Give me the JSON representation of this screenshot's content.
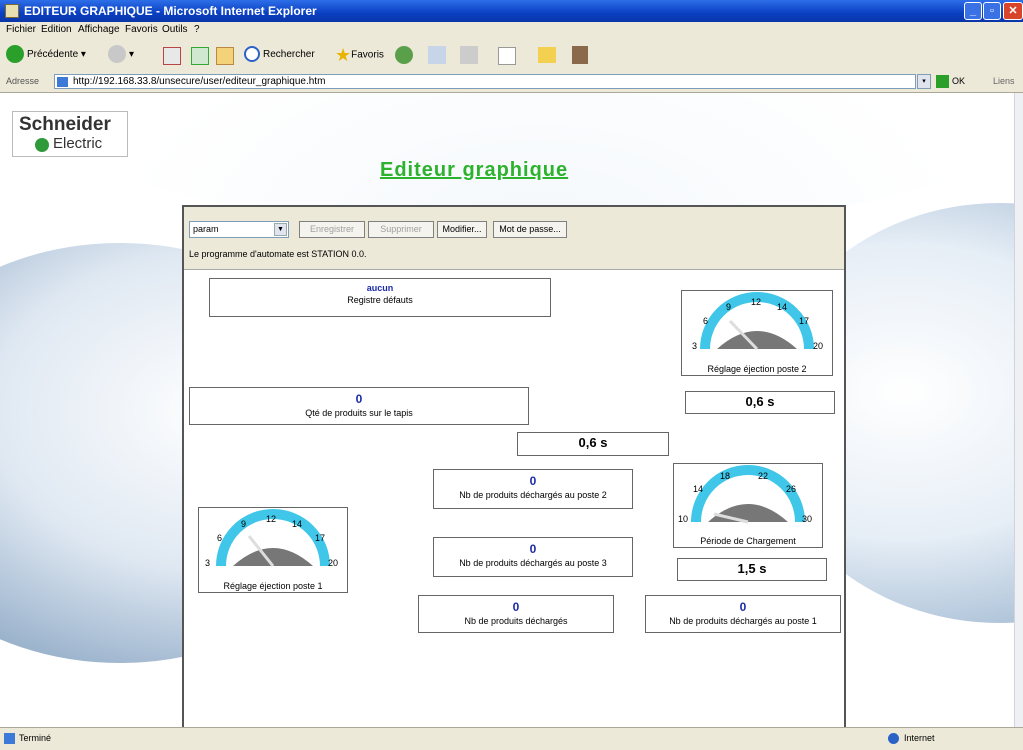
{
  "window": {
    "title": "EDITEUR GRAPHIQUE - Microsoft Internet Explorer"
  },
  "menu": [
    "Fichier",
    "Edition",
    "Affichage",
    "Favoris",
    "Outils",
    "?"
  ],
  "toolbar": {
    "back": "Précédente",
    "search": "Rechercher",
    "favorites": "Favoris"
  },
  "address": {
    "label": "Adresse",
    "url": "http://192.168.33.8/unsecure/user/editeur_graphique.htm",
    "go": "OK",
    "links": "Liens"
  },
  "logo": {
    "line1": "Schneider",
    "line2": "Electric"
  },
  "page": {
    "title": "Editeur graphique"
  },
  "editor": {
    "selected": "param",
    "buttons": {
      "save": "Enregistrer",
      "delete": "Supprimer",
      "modify": "Modifier...",
      "password": "Mot de passe..."
    },
    "program": "Le programme d'automate est STATION 0.0."
  },
  "panels": {
    "registre": {
      "value": "aucun",
      "label": "Registre défauts"
    },
    "qte": {
      "value": "0",
      "label": "Qté de produits sur le tapis"
    },
    "poste2": {
      "value": "0",
      "label": "Nb de produits déchargés au poste 2"
    },
    "poste3": {
      "value": "0",
      "label": "Nb de produits déchargés au poste 3"
    },
    "decharges": {
      "value": "0",
      "label": "Nb de produits déchargés"
    },
    "poste1": {
      "value": "0",
      "label": "Nb de produits déchargés au poste 1"
    }
  },
  "gauges": {
    "ejection2": {
      "label": "Réglage éjection poste 2",
      "ticks": [
        "3",
        "6",
        "9",
        "12",
        "14",
        "17",
        "20"
      ],
      "readout": "0,6 s"
    },
    "ejection1": {
      "label": "Réglage éjection poste 1",
      "ticks": [
        "3",
        "6",
        "9",
        "12",
        "14",
        "17",
        "20"
      ]
    },
    "chargement": {
      "label": "Période de Chargement",
      "ticks": [
        "10",
        "14",
        "18",
        "22",
        "26",
        "30"
      ],
      "readout": "1,5 s"
    }
  },
  "standalone_readout": "0,6 s",
  "status": {
    "left": "Terminé",
    "right": "Internet"
  },
  "colors": {
    "title_green": "#2cb22c",
    "value_blue": "#1a2aa8",
    "gauge_arc": "#3fc6e8"
  }
}
